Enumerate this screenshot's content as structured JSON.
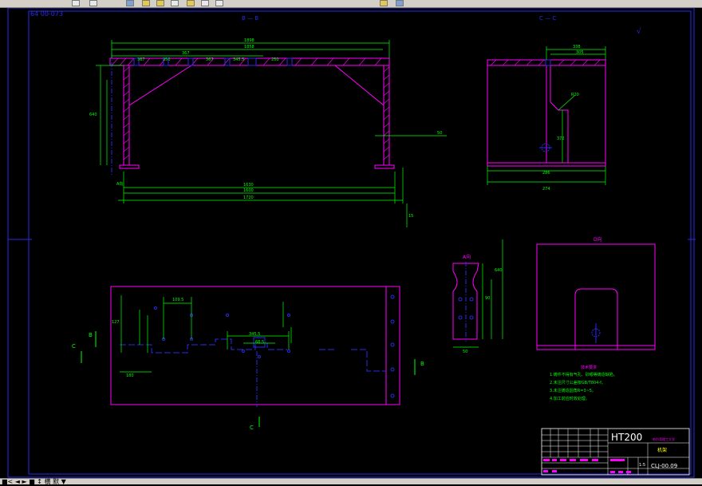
{
  "app": {
    "title_fragment": "64 00-073",
    "status_fragment": "■< ◄ ► ■ ↕ 横 默 ▼"
  },
  "drawing": {
    "view_bb": "B — B",
    "view_cc_top": "C — C",
    "view_a": "A向",
    "view_d": "D向",
    "label_b_left": "B",
    "label_b_right": "B",
    "label_c_left": "C",
    "label_c_bottom": "C",
    "surface_mark": "√",
    "dimensions": {
      "d1898": "1898",
      "d1858": "1858",
      "d1720": "1720",
      "d1600": "1600",
      "d1630": "1630",
      "d367": "367",
      "d345_5": "345.5",
      "d640": "640",
      "d338": "338",
      "d305": "305",
      "d286": "286",
      "d274": "274",
      "d127": "127",
      "d180": "180",
      "d50": "50",
      "d15": "15"
    },
    "notes": {
      "title": "技术要求",
      "line1": "1.铸件不得有气孔、砂眼等铸造缺陷。",
      "line2": "2.未注尺寸公差按GB/T804-f。",
      "line3": "3.未注铸造圆角R=3~5。",
      "line4": "4.加工前应时效处理。"
    },
    "title_block": {
      "material": "HT200",
      "part_name": "机架",
      "drawing_no": "CLJ-00.09",
      "scale": "1:5"
    }
  },
  "colors": {
    "border": "#2a2ae8",
    "outline": "#ff00ff",
    "dimension": "#00ff00",
    "hidden": "#2a2ae8",
    "hatch": "#ff00ff",
    "notes_text": "#00ff00",
    "title_text": "#ffffff"
  }
}
